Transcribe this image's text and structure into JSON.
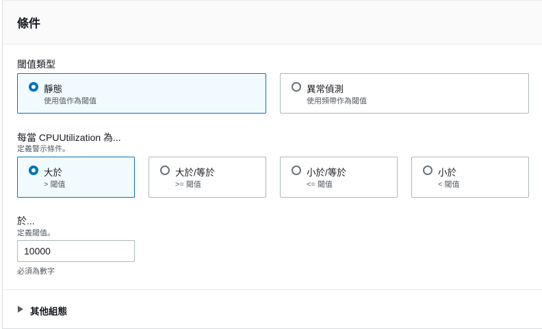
{
  "section": {
    "title": "條件"
  },
  "threshold_type": {
    "label": "閾值類型",
    "options": [
      {
        "title": "靜態",
        "desc": "使用值作為閾值"
      },
      {
        "title": "異常偵測",
        "desc": "使用頻帶作為閾值"
      }
    ],
    "selected": 0
  },
  "condition": {
    "label": "每當 CPUUtilization 為...",
    "desc": "定義警示條件。",
    "options": [
      {
        "title": "大於",
        "desc": "> 閾值"
      },
      {
        "title": "大於/等於",
        "desc": ">= 閾值"
      },
      {
        "title": "小於/等於",
        "desc": "<= 閾值"
      },
      {
        "title": "小於",
        "desc": "< 閾值"
      }
    ],
    "selected": 0
  },
  "threshold_value": {
    "label": "於...",
    "desc": "定義閾值。",
    "value": "10000",
    "hint": "必須為數字"
  },
  "additional": {
    "label": "其他組態"
  },
  "colors": {
    "accent": "#0073bb",
    "selected_bg": "#f1faff",
    "border": "#aab7b8"
  }
}
